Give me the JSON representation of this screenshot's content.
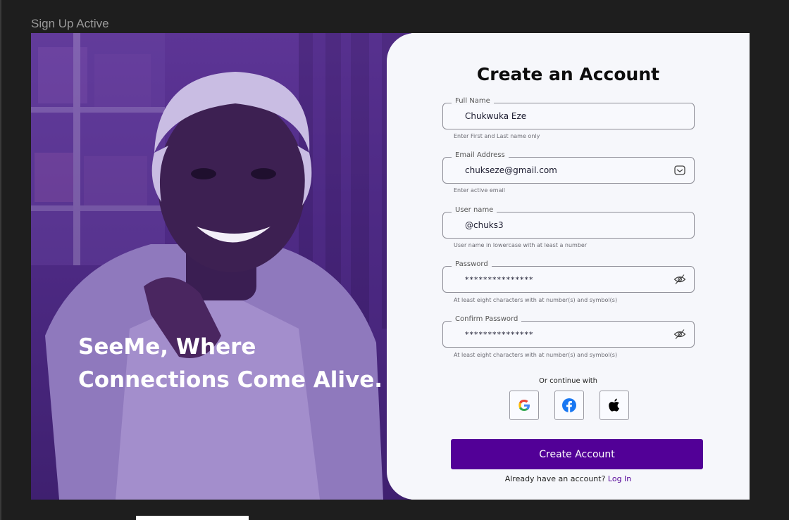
{
  "frame": {
    "label": "Sign Up Active"
  },
  "hero": {
    "tagline_line1": "SeeMe, Where",
    "tagline_line2": "Connections Come Alive."
  },
  "form": {
    "title": "Create an Account",
    "fields": [
      {
        "label": "Full Name",
        "value": "Chukwuka Eze",
        "hint": "Enter First and Last name only",
        "icon": ""
      },
      {
        "label": "Email Address",
        "value": "chukseze@gmail.com",
        "hint": "Enter active email",
        "icon": "envelope-icon"
      },
      {
        "label": "User name",
        "value": "@chuks3",
        "hint": "User name in lowercase with at least a number",
        "icon": ""
      },
      {
        "label": "Password",
        "value": "***************",
        "hint": "At least eight characters with at number(s) and symbol(s)",
        "icon": "eye-off-icon"
      },
      {
        "label": "Confirm Password",
        "value": "***************",
        "hint": "At least eight characters with at number(s) and symbol(s)",
        "icon": "eye-off-icon"
      }
    ],
    "or_continue": "Or continue with",
    "social": [
      "google-icon",
      "facebook-icon",
      "apple-icon"
    ],
    "submit_label": "Create Account",
    "login_prompt": "Already have an account?",
    "login_link": "Log In"
  },
  "colors": {
    "brand": "#520097",
    "hero_overlay": "#4f2b86",
    "background": "#1e1e1e"
  }
}
